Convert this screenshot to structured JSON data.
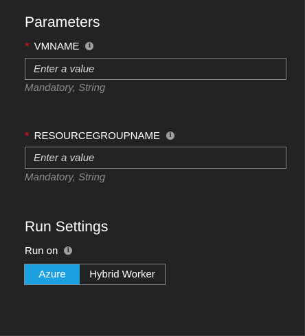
{
  "parameters": {
    "title": "Parameters",
    "fields": [
      {
        "label": "VMNAME",
        "required_mark": "*",
        "info_icon": "i",
        "placeholder": "Enter a value",
        "value": "",
        "hint": "Mandatory, String"
      },
      {
        "label": "RESOURCEGROUPNAME",
        "required_mark": "*",
        "info_icon": "i",
        "placeholder": "Enter a value",
        "value": "",
        "hint": "Mandatory, String"
      }
    ]
  },
  "run_settings": {
    "title": "Run Settings",
    "run_on_label": "Run on",
    "info_icon": "i",
    "options": [
      "Azure",
      "Hybrid Worker"
    ],
    "selected": "Azure"
  },
  "colors": {
    "background": "#232323",
    "accent": "#1ba1e2",
    "required": "#e81123",
    "hint": "#8a8a8a",
    "border": "#8a8a8a"
  }
}
